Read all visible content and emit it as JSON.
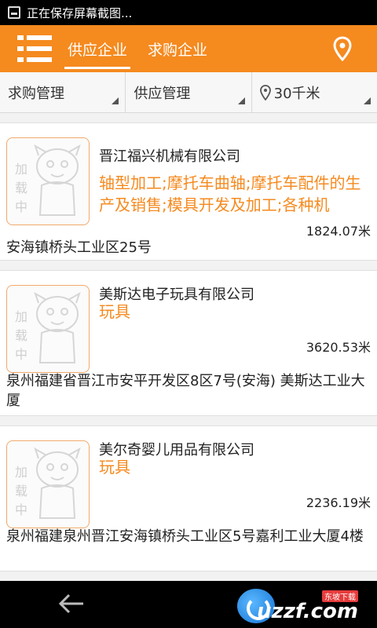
{
  "status_bar": {
    "notification": "正在保存屏幕截图..."
  },
  "app_bar": {
    "tabs": [
      {
        "label": "供应企业",
        "active": true
      },
      {
        "label": "求购企业",
        "active": false
      }
    ]
  },
  "filters": [
    {
      "label": "求购管理"
    },
    {
      "label": "供应管理"
    },
    {
      "label": "30千米"
    }
  ],
  "placeholder_text": "加载中",
  "companies": [
    {
      "name": "晋江福兴机械有限公司",
      "products": "轴型加工;摩托车曲轴;摩托车配件的生产及销售;模具开发及加工;各种机",
      "distance": "1824.07米",
      "address": "安海镇桥头工业区25号"
    },
    {
      "name": "美斯达电子玩具有限公司",
      "products": "玩具",
      "distance": "3620.53米",
      "address": "泉州福建省晋江市安平开发区8区7号(安海) 美斯达工业大厦"
    },
    {
      "name": "美尔奇婴儿用品有限公司",
      "products": "玩具",
      "distance": "2236.19米",
      "address": "泉州福建泉州晋江安海镇桥头工业区5号嘉利工业大厦4楼"
    }
  ],
  "watermark": {
    "text": "uzzf.com",
    "sub": "东坡下载"
  },
  "colors": {
    "accent": "#f58a1f",
    "status_bar": "#000000",
    "nav_bar": "#000000"
  },
  "icons": [
    "menu-icon",
    "location-pin-icon",
    "back-arrow-icon",
    "dropdown-triangle-icon",
    "screenshot-icon"
  ]
}
